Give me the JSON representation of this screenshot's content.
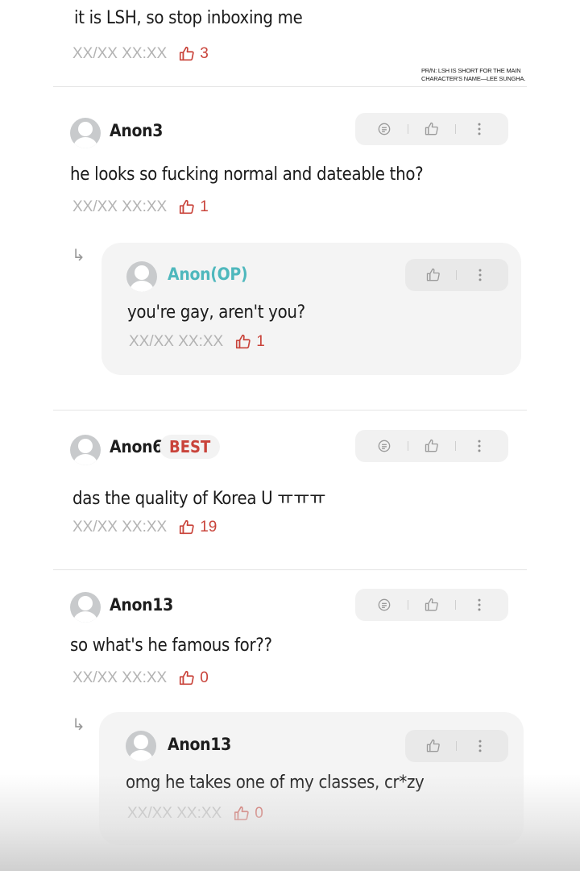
{
  "note": {
    "line1": "PR/N: LSH IS SHORT FOR THE MAIN",
    "line2": "CHARACTER'S NAME—LEE SUNGHA."
  },
  "comments": [
    {
      "text": "it is LSH, so stop inboxing me",
      "timestamp": "XX/XX XX:XX",
      "likes": "3"
    },
    {
      "username": "Anon3",
      "text": "he looks so fucking normal and dateable tho?",
      "timestamp": "XX/XX XX:XX",
      "likes": "1",
      "reply": {
        "username": "Anon(OP)",
        "text": "you're gay, aren't you?",
        "timestamp": "XX/XX XX:XX",
        "likes": "1"
      }
    },
    {
      "username": "Anon6",
      "badge": "BEST",
      "text": "das the quality of Korea U ㅠㅠㅠ",
      "timestamp": "XX/XX XX:XX",
      "likes": "19"
    },
    {
      "username": "Anon13",
      "text": "so what's he famous for??",
      "timestamp": "XX/XX XX:XX",
      "likes": "0",
      "reply": {
        "username": "Anon13",
        "text": "omg he takes one of my classes, cr*zy",
        "timestamp": "XX/XX XX:XX",
        "likes": "0"
      }
    }
  ],
  "icons": {
    "reply": "chat-icon",
    "like": "thumbs-up-icon",
    "more": "more-vertical-icon",
    "reply_indicator": "reply-arrow-icon"
  },
  "colors": {
    "likes": "#c9433a",
    "op_username": "#4fb8bd",
    "badge": "#c9433a",
    "timestamp": "#b3b3b3"
  }
}
